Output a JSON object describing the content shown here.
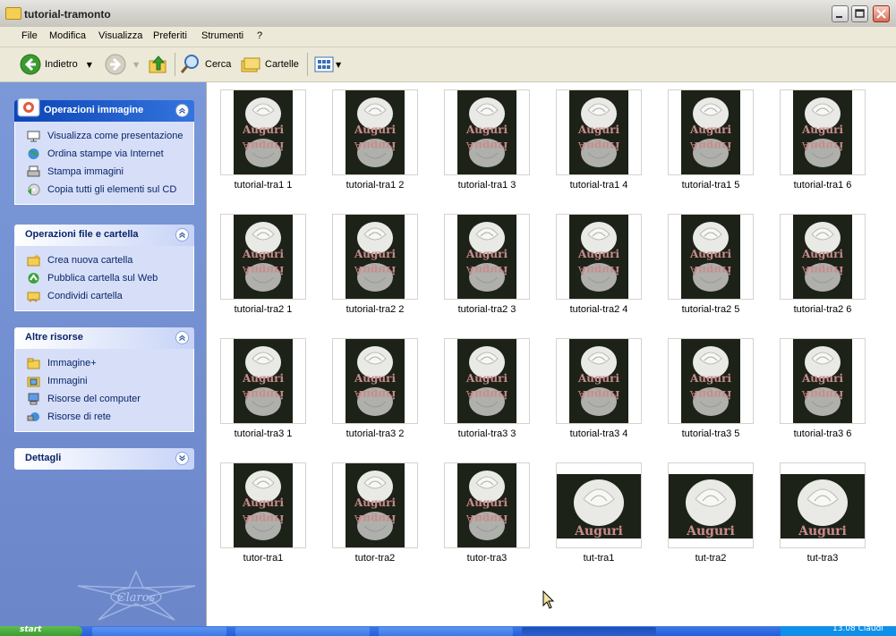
{
  "window": {
    "title": "tutorial-tramonto"
  },
  "menu": [
    "File",
    "Modifica",
    "Visualizza",
    "Preferiti",
    "Strumenti",
    "?"
  ],
  "toolbar": {
    "back_label": "Indietro",
    "search_label": "Cerca",
    "folders_label": "Cartelle"
  },
  "sidebar": {
    "image_tasks": {
      "title": "Operazioni immagine",
      "items": [
        "Visualizza come presentazione",
        "Ordina stampe via Internet",
        "Stampa immagini",
        "Copia tutti gli elementi sul CD"
      ]
    },
    "file_tasks": {
      "title": "Operazioni file e cartella",
      "items": [
        "Crea nuova cartella",
        "Pubblica cartella sul Web",
        "Condividi cartella"
      ]
    },
    "other_places": {
      "title": "Altre risorse",
      "items": [
        "Immagine+",
        "Immagini",
        "Risorse del computer",
        "Risorse di rete"
      ]
    },
    "details": {
      "title": "Dettagli"
    }
  },
  "files": [
    {
      "name": "tutorial-tra1 1",
      "kind": "portrait"
    },
    {
      "name": "tutorial-tra1 2",
      "kind": "portrait"
    },
    {
      "name": "tutorial-tra1 3",
      "kind": "portrait"
    },
    {
      "name": "tutorial-tra1 4",
      "kind": "portrait"
    },
    {
      "name": "tutorial-tra1 5",
      "kind": "portrait"
    },
    {
      "name": "tutorial-tra1 6",
      "kind": "portrait"
    },
    {
      "name": "tutorial-tra2 1",
      "kind": "portrait"
    },
    {
      "name": "tutorial-tra2 2",
      "kind": "portrait"
    },
    {
      "name": "tutorial-tra2 3",
      "kind": "portrait"
    },
    {
      "name": "tutorial-tra2 4",
      "kind": "portrait"
    },
    {
      "name": "tutorial-tra2 5",
      "kind": "portrait"
    },
    {
      "name": "tutorial-tra2 6",
      "kind": "portrait"
    },
    {
      "name": "tutorial-tra3 1",
      "kind": "portrait"
    },
    {
      "name": "tutorial-tra3 2",
      "kind": "portrait"
    },
    {
      "name": "tutorial-tra3 3",
      "kind": "portrait"
    },
    {
      "name": "tutorial-tra3 4",
      "kind": "portrait"
    },
    {
      "name": "tutorial-tra3 5",
      "kind": "portrait"
    },
    {
      "name": "tutorial-tra3 6",
      "kind": "portrait"
    },
    {
      "name": "tutor-tra1",
      "kind": "portrait"
    },
    {
      "name": "tutor-tra2",
      "kind": "portrait"
    },
    {
      "name": "tutor-tra3",
      "kind": "portrait"
    },
    {
      "name": "tut-tra1",
      "kind": "landscape"
    },
    {
      "name": "tut-tra2",
      "kind": "landscape"
    },
    {
      "name": "tut-tra3",
      "kind": "landscape"
    }
  ],
  "thumbnail_text": "Auguri",
  "watermark_text": "Claros",
  "taskbar": {
    "start_label": "start",
    "clock": "13.08 Claudi"
  },
  "colors": {
    "sidebar": "#7b99d9",
    "panel_body": "#d6dff7",
    "link": "#0a246a",
    "taskbar": "#245edb"
  }
}
